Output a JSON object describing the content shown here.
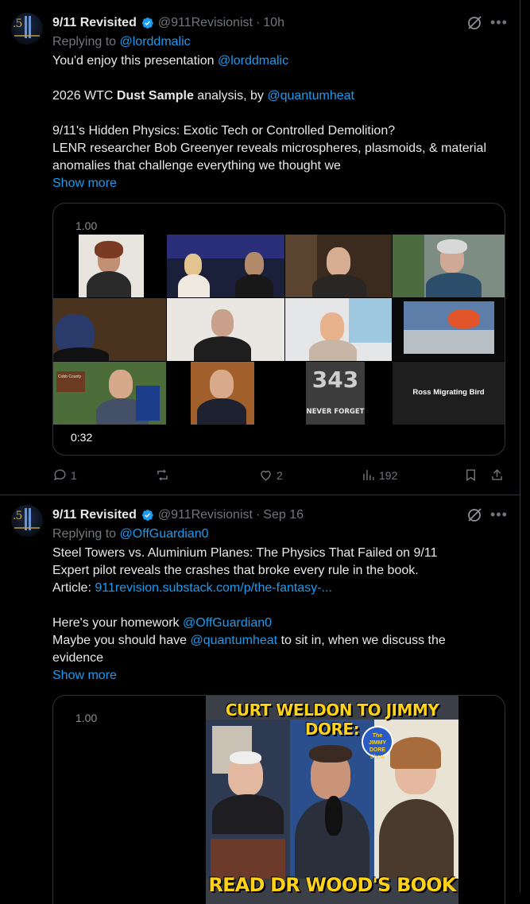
{
  "colors": {
    "background": "#000000",
    "text": "#e7e9ea",
    "muted": "#71767b",
    "link": "#1d9bf0",
    "verified": "#1d9bf0"
  },
  "tweets": [
    {
      "name": "9/11 Revisited",
      "handle": "@911Revisionist",
      "time": "10h",
      "replying_prefix": "Replying to",
      "replying_to": "@lorddmalic",
      "line1_text": "You'd enjoy this presentation",
      "line1_mention": "@lorddmalic",
      "line2_a": "2026 WTC",
      "line2_bold": "Dust Sample",
      "line2_b": "analysis, by",
      "line2_mention": "@quantumheat",
      "line3": "9/11's Hidden Physics: Exotic Tech or Controlled Demolition?",
      "line4": "LENR researcher Bob Greenyer reveals microspheres, plasmoids, & material",
      "line5": "anomalies that challenge everything we thought we",
      "show_more": "Show more",
      "video": {
        "speed": "1.00",
        "duration": "0:32",
        "participant_name": "Ross Migrating Bird",
        "tile_label_sign": "Cobb County",
        "memorial_number": "343",
        "memorial_text": "NEVER FORGET"
      },
      "actions": {
        "replies": "1",
        "reposts": "",
        "likes": "2",
        "views": "192"
      }
    },
    {
      "name": "9/11 Revisited",
      "handle": "@911Revisionist",
      "time": "Sep 16",
      "replying_prefix": "Replying to",
      "replying_to": "@OffGuardian0",
      "line1": "Steel Towers vs. Aluminium Planes: The Physics That Failed on 9/11",
      "line2": "Expert pilot reveals the crashes that broke every rule in the book.",
      "line3_label": "Article:",
      "line3_link": "911revision.substack.com/p/the-fantasy-...",
      "line4_text": "Here's your homework",
      "line4_mention": "@OffGuardian0",
      "line5_a": "Maybe you should have",
      "line5_mention": "@quantumheat",
      "line5_b": "to sit in, when we discuss the",
      "line6": "evidence",
      "show_more": "Show more",
      "video": {
        "speed": "1.00",
        "thumb_title": "CURT WELDON TO JIMMY DORE:",
        "thumb_bottom": "READ DR WOOD'S BOOK",
        "show_badge": "The JIMMY DORE Show"
      }
    }
  ]
}
